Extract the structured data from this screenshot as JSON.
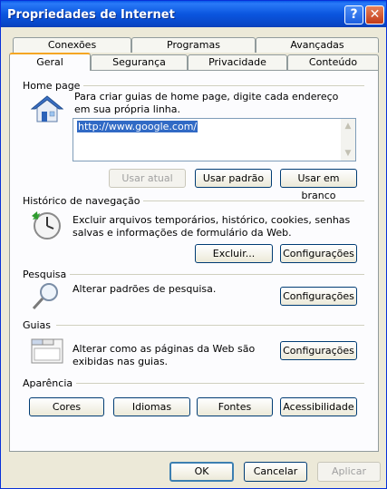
{
  "window": {
    "title": "Propriedades de Internet"
  },
  "tabs": {
    "row_back": [
      "Conexões",
      "Programas",
      "Avançadas"
    ],
    "row_front": [
      "Geral",
      "Segurança",
      "Privacidade",
      "Conteúdo"
    ],
    "active": "Geral"
  },
  "home_page": {
    "label": "Home page",
    "description": "Para criar guias de home page, digite cada endereço em sua própria linha.",
    "url_value": "http://www.google.com/",
    "btn_current": "Usar atual",
    "btn_default": "Usar padrão",
    "btn_blank": "Usar em branco"
  },
  "history": {
    "label": "Histórico de navegação",
    "description": "Excluir arquivos temporários, histórico, cookies, senhas salvas e informações de formulário da Web.",
    "btn_delete": "Excluir...",
    "btn_settings": "Configurações"
  },
  "search": {
    "label": "Pesquisa",
    "description": "Alterar padrões de pesquisa.",
    "btn_settings": "Configurações"
  },
  "tabs_section": {
    "label": "Guias",
    "description": "Alterar como as páginas da Web são exibidas nas guias.",
    "btn_settings": "Configurações"
  },
  "appearance": {
    "label": "Aparência",
    "btn_colors": "Cores",
    "btn_languages": "Idiomas",
    "btn_fonts": "Fontes",
    "btn_accessibility": "Acessibilidade"
  },
  "footer": {
    "ok": "OK",
    "cancel": "Cancelar",
    "apply": "Aplicar"
  },
  "icons": {
    "help": "?",
    "close": "✕",
    "scroll_up": "▲",
    "scroll_down": "▼"
  }
}
